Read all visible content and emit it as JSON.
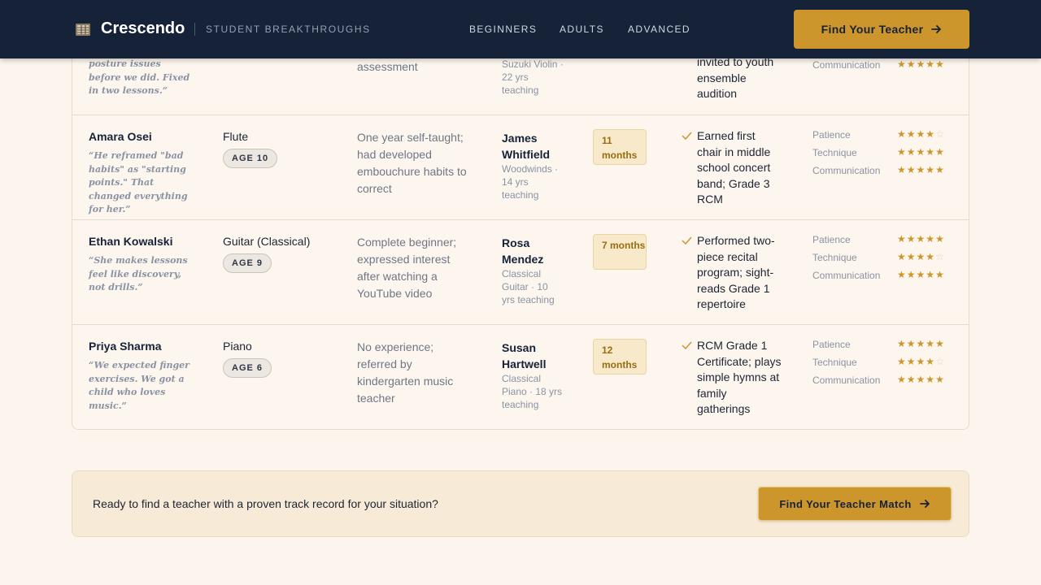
{
  "header": {
    "brand": "Crescendo",
    "tagline": "STUDENT BREAKTHROUGHS",
    "nav": [
      "BEGINNERS",
      "ADULTS",
      "ADVANCED"
    ],
    "cta_label": "Find Your Teacher"
  },
  "rating_labels": [
    "Patience",
    "Technique",
    "Communication"
  ],
  "rows": [
    {
      "name": "",
      "quote": "posture issues before we did. Fixed in two lessons.”",
      "instrument": "",
      "age": "",
      "start": "assessment",
      "teacher": "",
      "teacher_meta": "Suzuki Violin · 22 yrs teaching",
      "duration": "",
      "outcome": "invited to youth ensemble audition",
      "ratings_label": "Communication",
      "ratings": [
        5
      ]
    },
    {
      "name": "Amara Osei",
      "quote": "“He reframed \"bad habits\" as \"starting points.\" That changed everything for her.”",
      "instrument": "Flute",
      "age": "AGE 10",
      "start": "One year self-taught; had developed embouchure habits to correct",
      "teacher": "James Whitfield",
      "teacher_meta": "Woodwinds · 14 yrs teaching",
      "duration": "11 months",
      "outcome": "Earned first chair in middle school concert band; Grade 3 RCM",
      "ratings": [
        4,
        5,
        5
      ]
    },
    {
      "name": "Ethan Kowalski",
      "quote": "“She makes lessons feel like discovery, not drills.”",
      "instrument": "Guitar (Classical)",
      "age": "AGE 9",
      "start": "Complete beginner; expressed interest after watching a YouTube video",
      "teacher": "Rosa Mendez",
      "teacher_meta": "Classical Guitar · 10 yrs teaching",
      "duration": "7 months",
      "outcome": "Performed two-piece recital program; sight-reads Grade 1 repertoire",
      "ratings": [
        5,
        4,
        5
      ]
    },
    {
      "name": "Priya Sharma",
      "quote": "“We expected finger exercises. We got a child who loves music.”",
      "instrument": "Piano",
      "age": "AGE 6",
      "start": "No experience; referred by kindergarten music teacher",
      "teacher": "Susan Hartwell",
      "teacher_meta": "Classical Piano · 18 yrs teaching",
      "duration": "12 months",
      "outcome": "RCM Grade 1 Certificate; plays simple hymns at family gatherings",
      "ratings": [
        5,
        4,
        5
      ]
    }
  ],
  "cta_bar": {
    "text": "Ready to find a teacher with a proven track record for your situation?",
    "button_label": "Find Your Teacher Match"
  },
  "colors": {
    "header_bg": "#152238",
    "accent": "#cc962c",
    "page_bg": "#fbf5ee",
    "duration_bg": "#f7e9c9"
  }
}
